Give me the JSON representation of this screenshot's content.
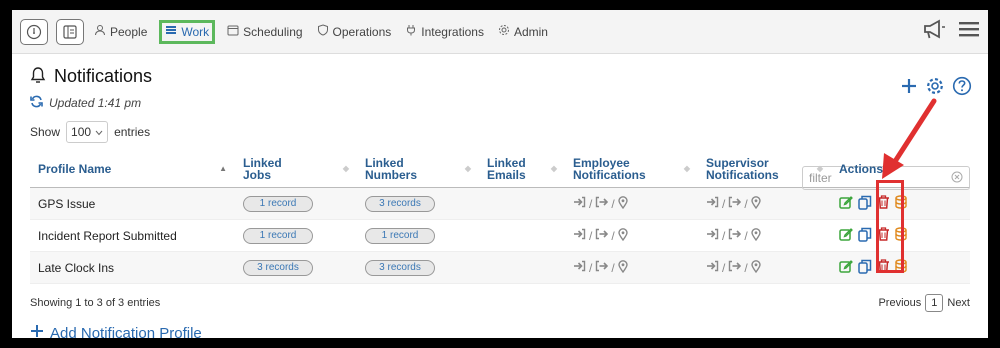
{
  "nav": {
    "items": [
      {
        "label": "People",
        "icon": "person-icon"
      },
      {
        "label": "Work",
        "icon": "list-icon",
        "active": true
      },
      {
        "label": "Scheduling",
        "icon": "calendar-icon"
      },
      {
        "label": "Operations",
        "icon": "shield-icon"
      },
      {
        "label": "Integrations",
        "icon": "plug-icon"
      },
      {
        "label": "Admin",
        "icon": "gear-icon"
      }
    ]
  },
  "page": {
    "title": "Notifications",
    "updated": "Updated 1:41 pm"
  },
  "table_controls": {
    "show_label": "Show",
    "entries_value": "100",
    "entries_label": "entries",
    "filter_placeholder": "filter"
  },
  "table": {
    "headers": [
      {
        "line1": "Profile Name",
        "line2": ""
      },
      {
        "line1": "Linked",
        "line2": "Jobs"
      },
      {
        "line1": "Linked",
        "line2": "Numbers"
      },
      {
        "line1": "Linked",
        "line2": "Emails"
      },
      {
        "line1": "Employee",
        "line2": "Notifications"
      },
      {
        "line1": "Supervisor",
        "line2": "Notifications"
      },
      {
        "line1": "Actions",
        "line2": ""
      }
    ],
    "rows": [
      {
        "name": "GPS Issue",
        "jobs": "1 record",
        "numbers": "3 records"
      },
      {
        "name": "Incident Report Submitted",
        "jobs": "1 record",
        "numbers": "1 record"
      },
      {
        "name": "Late Clock Ins",
        "jobs": "3 records",
        "numbers": "3 records"
      }
    ],
    "separator": "/"
  },
  "footer": {
    "info": "Showing 1 to 3 of 3 entries",
    "previous": "Previous",
    "page": "1",
    "next": "Next"
  },
  "add_profile": "Add Notification Profile",
  "colors": {
    "accent": "#2a6ab0",
    "active_nav_border": "#5cb85c",
    "annotation": "#e03030",
    "edit": "#3ca53c",
    "delete": "#c62828",
    "archive": "#e08a1e"
  }
}
